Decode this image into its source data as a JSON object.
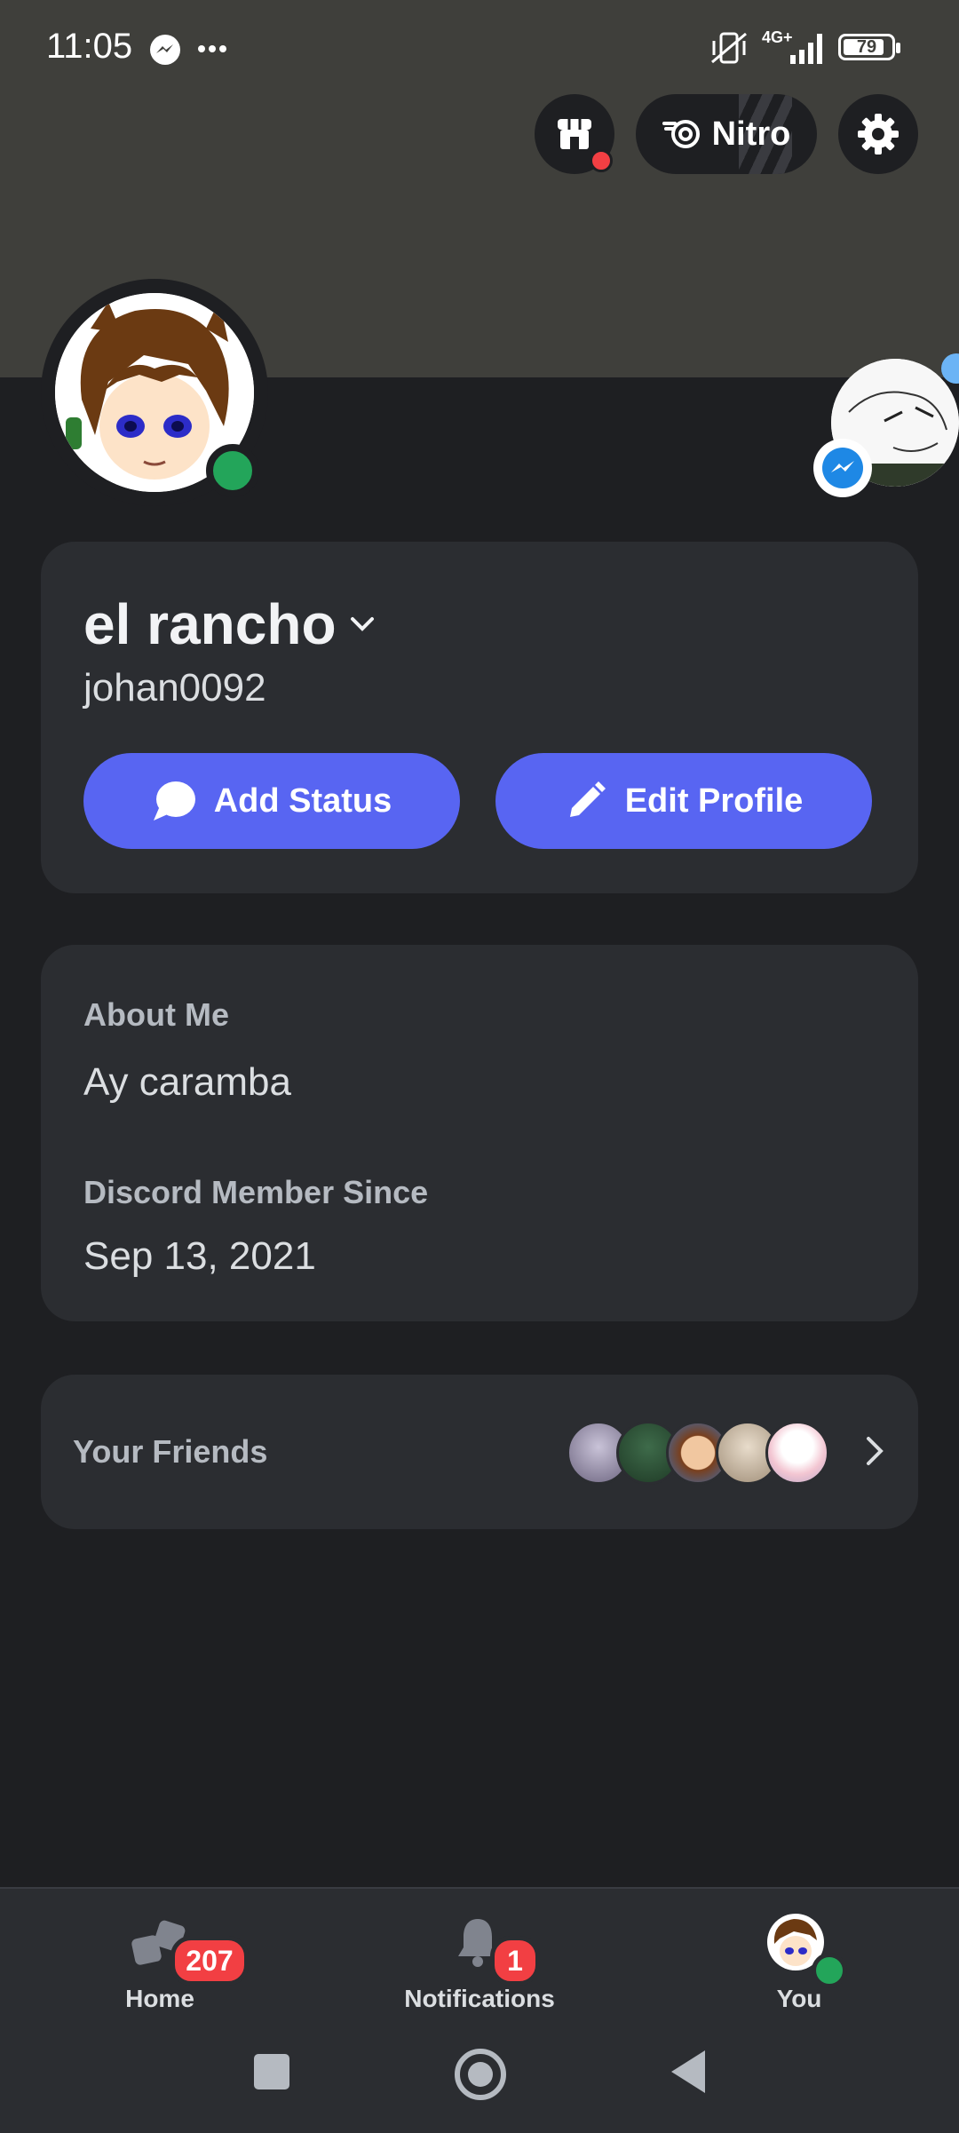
{
  "status_bar": {
    "time": "11:05",
    "network": "4G+",
    "battery": "79",
    "icons": [
      "messenger-icon",
      "more-dots-icon",
      "muted-vibrate-icon",
      "signal-icon",
      "battery-icon"
    ]
  },
  "header": {
    "shop_icon": "shop-icon",
    "nitro_label": "Nitro",
    "settings_icon": "gear-icon"
  },
  "profile": {
    "display_name": "el rancho",
    "username": "johan0092",
    "status": "online",
    "add_status_label": "Add Status",
    "edit_profile_label": "Edit Profile"
  },
  "about": {
    "about_title": "About Me",
    "about_text": "Ay caramba",
    "member_since_title": "Discord Member Since",
    "member_since_value": "Sep 13, 2021"
  },
  "friends": {
    "title": "Your Friends",
    "avatar_count": 5
  },
  "bottom_nav": {
    "home_label": "Home",
    "home_badge": "207",
    "notifications_label": "Notifications",
    "notifications_badge": "1",
    "you_label": "You"
  },
  "colors": {
    "accent": "#5865f2",
    "online": "#23a55a",
    "badge": "#f23f43",
    "banner": "#3f3f3b"
  }
}
